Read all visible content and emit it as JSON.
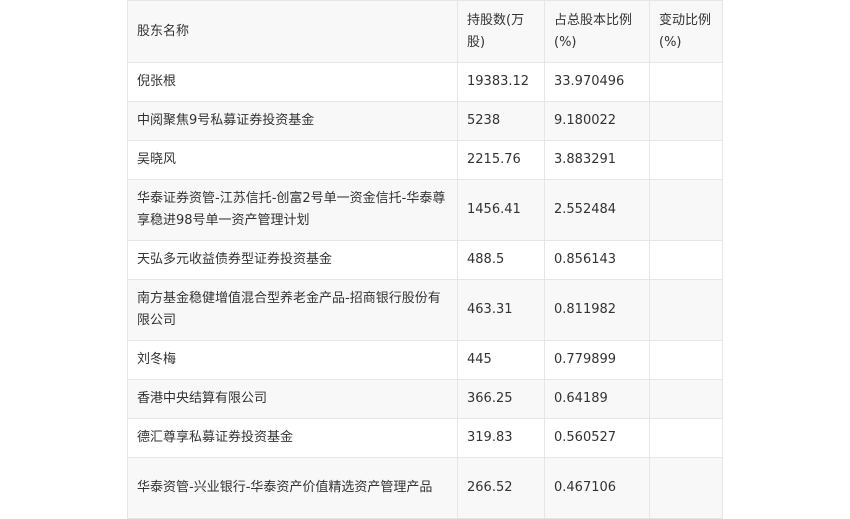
{
  "table": {
    "headers": [
      "股东名称",
      "持股数(万股)",
      "占总股本比例(%)",
      "变动比例(%)"
    ],
    "rows": [
      [
        "倪张根",
        "19383.12",
        "33.970496",
        ""
      ],
      [
        "中阅聚焦9号私募证券投资基金",
        "5238",
        "9.180022",
        ""
      ],
      [
        "吴晓风",
        "2215.76",
        "3.883291",
        ""
      ],
      [
        "华泰证券资管-江苏信托-创富2号单一资金信托-华泰尊享稳进98号单一资产管理计划",
        "1456.41",
        "2.552484",
        ""
      ],
      [
        "天弘多元收益债券型证券投资基金",
        "488.5",
        "0.856143",
        ""
      ],
      [
        "南方基金稳健增值混合型养老金产品-招商银行股份有限公司",
        "463.31",
        "0.811982",
        ""
      ],
      [
        "刘冬梅",
        "445",
        "0.779899",
        ""
      ],
      [
        "香港中央结算有限公司",
        "366.25",
        "0.64189",
        ""
      ],
      [
        "德汇尊享私募证券投资基金",
        "319.83",
        "0.560527",
        ""
      ],
      [
        "华泰资管-兴业银行-华泰资产价值精选资产管理产品",
        "266.52",
        "0.467106",
        ""
      ]
    ]
  }
}
